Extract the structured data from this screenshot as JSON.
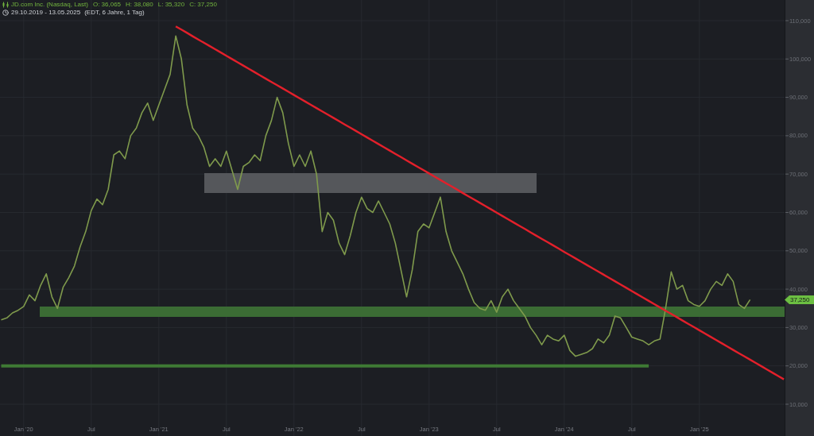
{
  "legend": {
    "quotes": [
      "O: 36,065",
      "H: 38,080",
      "L: 35,320",
      "C: 37,250"
    ],
    "period": "29.10.2019 - 13.05.2025",
    "details": "(EDT, 6 Jahre, 1 Tag)"
  },
  "chart_data": {
    "type": "line",
    "grid": true,
    "ylim": [
      1720,
      115380
    ],
    "yticks": [
      {
        "value": 110000,
        "label": "110,000"
      },
      {
        "value": 100000,
        "label": "100,000"
      },
      {
        "value": 90000,
        "label": "90,000"
      },
      {
        "value": 80000,
        "label": "80,000"
      },
      {
        "value": 70000,
        "label": "70,000"
      },
      {
        "value": 60000,
        "label": "60,000"
      },
      {
        "value": 50000,
        "label": "50,000"
      },
      {
        "value": 40000,
        "label": "40,000"
      },
      {
        "value": 30000,
        "label": "30,000"
      },
      {
        "value": 20000,
        "label": "20,000"
      },
      {
        "value": 10000,
        "label": "10,000"
      }
    ],
    "categories": [
      null,
      null,
      null,
      null,
      "Jan '20",
      null,
      null,
      null,
      null,
      null,
      null,
      null,
      null,
      null,
      null,
      null,
      "Jul",
      null,
      null,
      null,
      null,
      null,
      null,
      null,
      null,
      null,
      null,
      null,
      "Jan '21",
      null,
      null,
      null,
      null,
      null,
      null,
      null,
      null,
      null,
      null,
      null,
      "Jul",
      null,
      null,
      null,
      null,
      null,
      null,
      null,
      null,
      null,
      null,
      null,
      "Jan '22",
      null,
      null,
      null,
      null,
      null,
      null,
      null,
      null,
      null,
      null,
      null,
      "Jul",
      null,
      null,
      null,
      null,
      null,
      null,
      null,
      null,
      null,
      null,
      null,
      "Jan '23",
      null,
      null,
      null,
      null,
      null,
      null,
      null,
      null,
      null,
      null,
      null,
      "Jul",
      null,
      null,
      null,
      null,
      null,
      null,
      null,
      null,
      null,
      null,
      null,
      "Jan '24",
      null,
      null,
      null,
      null,
      null,
      null,
      null,
      null,
      null,
      null,
      null,
      "Jul",
      null,
      null,
      null,
      null,
      null,
      null,
      null,
      null,
      null,
      null,
      null,
      "Jan '25",
      null,
      null,
      null,
      null,
      null,
      null,
      null,
      null,
      null,
      null,
      null,
      null,
      null,
      null,
      null
    ],
    "series": [
      {
        "name": "JD.com Inc. (Nasdaq, Last)",
        "color": "#7f9a4c",
        "values": [
          32000,
          32500,
          33800,
          34500,
          35500,
          38500,
          37000,
          41000,
          44000,
          38000,
          35000,
          40500,
          43000,
          46000,
          51000,
          55000,
          60500,
          63500,
          62000,
          66000,
          75000,
          76000,
          74000,
          80000,
          82000,
          86000,
          88500,
          84000,
          88000,
          92000,
          96000,
          106000,
          100000,
          88000,
          82000,
          80000,
          77000,
          72000,
          74000,
          72000,
          76000,
          71000,
          66000,
          72000,
          73000,
          75000,
          73500,
          80000,
          84000,
          90000,
          86000,
          78000,
          72000,
          75000,
          72000,
          76000,
          70000,
          55000,
          60000,
          58000,
          52000,
          49000,
          54000,
          60000,
          64000,
          61000,
          60000,
          63000,
          60000,
          57000,
          52000,
          45000,
          38000,
          45000,
          55000,
          57000,
          56000,
          60000,
          64000,
          55000,
          50000,
          47000,
          44000,
          40000,
          36500,
          35000,
          34500,
          37000,
          34000,
          38000,
          40000,
          37000,
          35000,
          33000,
          30000,
          28000,
          25500,
          28000,
          27000,
          26500,
          28000,
          24000,
          22500,
          23000,
          23500,
          24500,
          27000,
          26000,
          28000,
          33000,
          32500,
          30000,
          27500,
          27000,
          26500,
          25500,
          26500,
          27000,
          35000,
          44500,
          40000,
          41000,
          37000,
          36000,
          35500,
          37000,
          40000,
          42000,
          41000,
          44000,
          42000,
          36000,
          35000,
          37250,
          null,
          null,
          null,
          null,
          null,
          null
        ]
      },
      {
        "color": "#e3202b",
        "values": [
          null,
          null,
          null,
          null,
          null,
          null,
          null,
          null,
          null,
          null,
          null,
          null,
          null,
          null,
          null,
          null,
          null,
          null,
          null,
          null,
          null,
          null,
          null,
          null,
          null,
          null,
          null,
          null,
          null,
          null,
          null,
          108500,
          107650,
          106800,
          105940,
          105090,
          104240,
          103390,
          102540,
          101690,
          100830,
          99980,
          99130,
          98280,
          97430,
          96570,
          95720,
          94870,
          94020,
          93170,
          92320,
          91460,
          90610,
          89760,
          88910,
          88060,
          87200,
          86350,
          85500,
          84650,
          83800,
          82940,
          82090,
          81240,
          80390,
          79540,
          78690,
          77830,
          76980,
          76130,
          75280,
          74430,
          73570,
          72720,
          71870,
          71020,
          70170,
          69320,
          68460,
          67610,
          66760,
          65910,
          65060,
          64200,
          63350,
          62500,
          61650,
          60800,
          59940,
          59090,
          58240,
          57390,
          56540,
          55690,
          54830,
          53980,
          53130,
          52280,
          51430,
          50570,
          49720,
          48870,
          48020,
          47170,
          46320,
          45460,
          44610,
          43760,
          42910,
          42060,
          41200,
          40350,
          39500,
          38650,
          37800,
          36940,
          36090,
          35240,
          34390,
          33540,
          32690,
          31830,
          30980,
          30130,
          29280,
          28430,
          27570,
          26720,
          25870,
          25020,
          24170,
          23320,
          22460,
          21610,
          20760,
          19910,
          19060,
          18200,
          17350,
          16500
        ]
      },
      {
        "color": "#3e7a34",
        "values": [
          20000,
          20000,
          20000,
          20000,
          20000,
          20000,
          20000,
          20000,
          20000,
          20000,
          20000,
          20000,
          20000,
          20000,
          20000,
          20000,
          20000,
          20000,
          20000,
          20000,
          20000,
          20000,
          20000,
          20000,
          20000,
          20000,
          20000,
          20000,
          20000,
          20000,
          20000,
          20000,
          20000,
          20000,
          20000,
          20000,
          20000,
          20000,
          20000,
          20000,
          20000,
          20000,
          20000,
          20000,
          20000,
          20000,
          20000,
          20000,
          20000,
          20000,
          20000,
          20000,
          20000,
          20000,
          20000,
          20000,
          20000,
          20000,
          20000,
          20000,
          20000,
          20000,
          20000,
          20000,
          20000,
          20000,
          20000,
          20000,
          20000,
          20000,
          20000,
          20000,
          20000,
          20000,
          20000,
          20000,
          20000,
          20000,
          20000,
          20000,
          20000,
          20000,
          20000,
          20000,
          20000,
          20000,
          20000,
          20000,
          20000,
          20000,
          20000,
          20000,
          20000,
          20000,
          20000,
          20000,
          20000,
          20000,
          20000,
          20000,
          20000,
          20000,
          20000,
          20000,
          20000,
          20000,
          20000,
          20000,
          20000,
          20000,
          20000,
          20000,
          20000,
          20000,
          20000,
          20000,
          null,
          null,
          null,
          null,
          null,
          null,
          null,
          null,
          null,
          null,
          null,
          null,
          null,
          null,
          null,
          null,
          null,
          null,
          null,
          null,
          null,
          null,
          null,
          null
        ]
      }
    ]
  },
  "drawings": [
    {
      "kind": "zone",
      "color": "#3b6c34"
    },
    {
      "kind": "zone",
      "color": "#55575b"
    }
  ],
  "price_axis": {
    "last_price": "37,250"
  }
}
